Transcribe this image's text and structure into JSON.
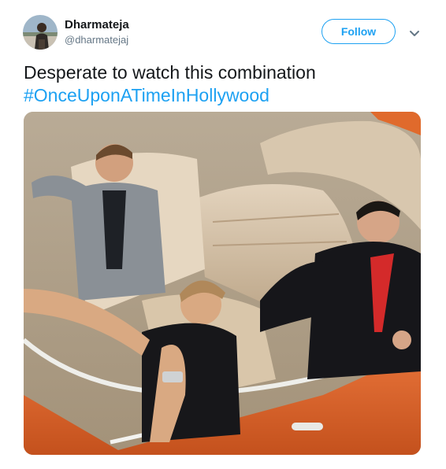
{
  "author": {
    "display_name": "Dharmateja",
    "handle": "@dharmatejaj",
    "avatar_icon": "user-avatar"
  },
  "follow_button": {
    "label": "Follow"
  },
  "menu": {
    "icon": "chevron-down-icon"
  },
  "tweet": {
    "text": "Desperate to watch this combination",
    "hashtag": "#OnceUponATimeInHollywood"
  },
  "media": {
    "subject": "three men seated in an orange vintage convertible car"
  },
  "colors": {
    "accent": "#1da1f2",
    "text_primary": "#14171a",
    "text_secondary": "#657786"
  }
}
